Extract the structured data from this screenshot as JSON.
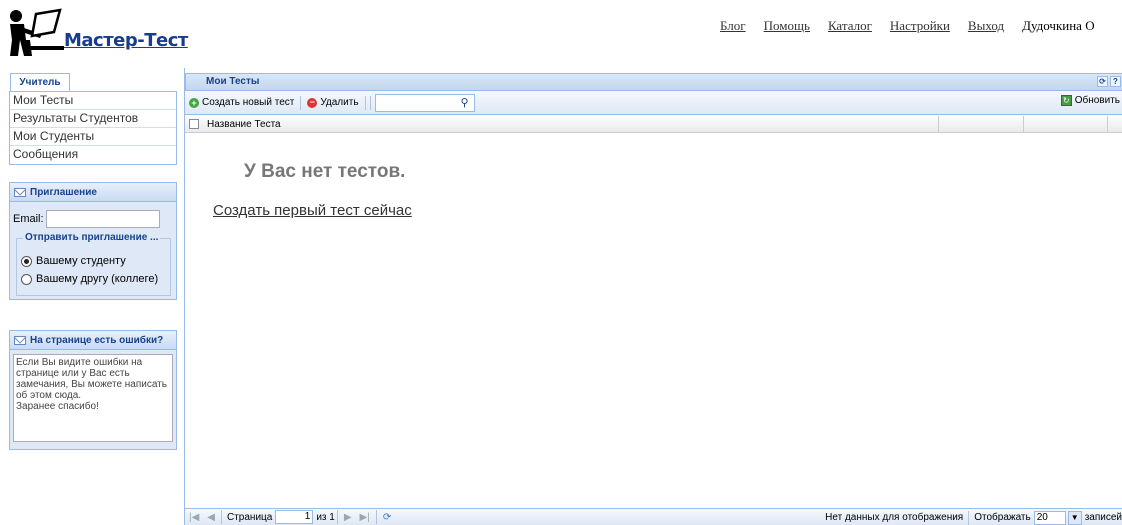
{
  "header": {
    "logo_text": "Мастер-Тест",
    "nav": [
      "Блог",
      "Помощь",
      "Каталог",
      "Настройки",
      "Выход"
    ],
    "user_name": "Дудочкина О"
  },
  "sidebar": {
    "tab_label": "Учитель",
    "items": [
      {
        "label": "Мои Тесты"
      },
      {
        "label": "Результаты Студентов"
      },
      {
        "label": "Мои Студенты"
      },
      {
        "label": "Сообщения"
      }
    ]
  },
  "invite": {
    "title": "Приглашение",
    "email_label": "Email:",
    "email_value": "",
    "fieldset_legend": "Отправить приглашение ...",
    "options": [
      {
        "label": "Вашему студенту",
        "selected": true
      },
      {
        "label": "Вашему другу (коллеге)",
        "selected": false
      }
    ]
  },
  "errors_panel": {
    "title": "На странице есть ошибки?",
    "text": "Если Вы видите ошибки на странице или у Вас есть замечания, Вы можете написать об этом сюда.\nЗаранее спасибо!"
  },
  "grid": {
    "title": "Мои Тесты",
    "toolbar": {
      "create_label": "Создать новый тест",
      "delete_label": "Удалить",
      "search_value": "",
      "refresh_label": "Обновить"
    },
    "column_header": "Название Теста",
    "empty_message": "У Вас нет тестов.",
    "empty_link": "Создать первый тест сейчас"
  },
  "pager": {
    "page_label": "Страница",
    "page_value": "1",
    "of_label": "из 1",
    "no_data": "Нет данных для отображения",
    "show_label": "Отображать",
    "page_size": "20",
    "records_label": "записей"
  },
  "colors": {
    "accent": "#15428b",
    "border": "#99bbe8",
    "panel_bg": "#dfe8f6"
  }
}
